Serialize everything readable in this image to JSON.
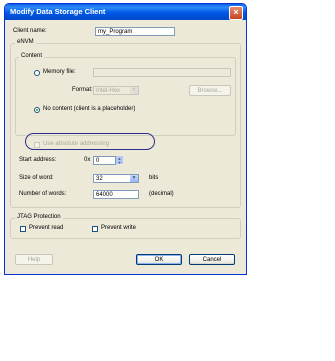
{
  "window": {
    "title": "Modify Data Storage Client",
    "close_icon": "close-icon"
  },
  "client_name": {
    "label": "Client name:",
    "value": "my_Program"
  },
  "envm_group": {
    "title": "eNVM",
    "content_label": "Content",
    "memory_file_label": "Memory file:",
    "memory_file_value": "",
    "format_label": "Format:",
    "format_value": "Intel-Hex",
    "browse_label": "Browse...",
    "no_content_label": "No content (client is a placeholder)",
    "no_content_selected": true,
    "use_absolute_label": "Use absolute addressing",
    "start_address_label": "Start address:",
    "start_address_prefix": "0x",
    "start_address_value": "0",
    "size_of_word_label": "Size of word:",
    "size_of_word_value": "32",
    "size_of_word_unit": "bits",
    "number_of_words_label": "Number of words:",
    "number_of_words_value": "64000",
    "number_of_words_unit": "(decimal)"
  },
  "jtag_group": {
    "title": "JTAG Protection",
    "prevent_read_label": "Prevent read",
    "prevent_write_label": "Prevent write"
  },
  "buttons": {
    "help": "Help",
    "ok": "OK",
    "cancel": "Cancel"
  },
  "colors": {
    "title_bar": "#0058e6",
    "dialog_bg": "#ece9d8",
    "highlight_oval": "#2d2f8a"
  }
}
